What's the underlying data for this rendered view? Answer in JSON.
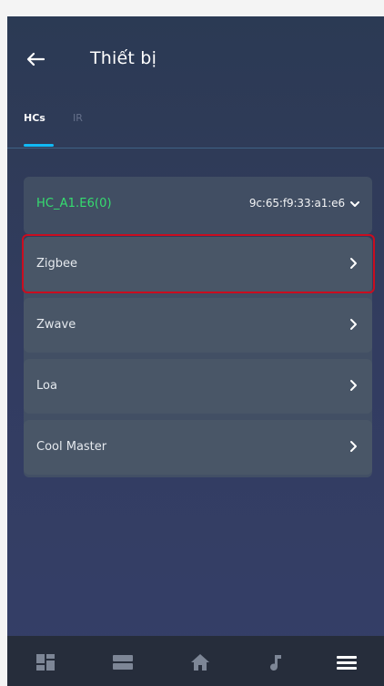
{
  "header": {
    "title": "Thiết bị"
  },
  "tabs": [
    {
      "label": "HCs",
      "active": true
    },
    {
      "label": "IR",
      "active": false
    }
  ],
  "hc_card": {
    "name": "HC_A1.E6(0)",
    "mac": "9c:65:f9:33:a1:e6",
    "name_color": "#35dd6f"
  },
  "device_groups": [
    {
      "label": "Zigbee",
      "highlighted": true
    },
    {
      "label": "Zwave",
      "highlighted": false
    },
    {
      "label": "Loa",
      "highlighted": false
    },
    {
      "label": "Cool Master",
      "highlighted": false
    }
  ],
  "bottom_nav": [
    {
      "icon": "dashboard-icon"
    },
    {
      "icon": "rooms-icon"
    },
    {
      "icon": "home-icon"
    },
    {
      "icon": "music-icon"
    },
    {
      "icon": "menu-icon"
    }
  ],
  "colors": {
    "accent": "#11b9f5",
    "highlight_border": "#c90d1f",
    "background_top": "#2b3a54",
    "background_bottom": "#353f68",
    "bottom_bar": "#262d3b"
  }
}
